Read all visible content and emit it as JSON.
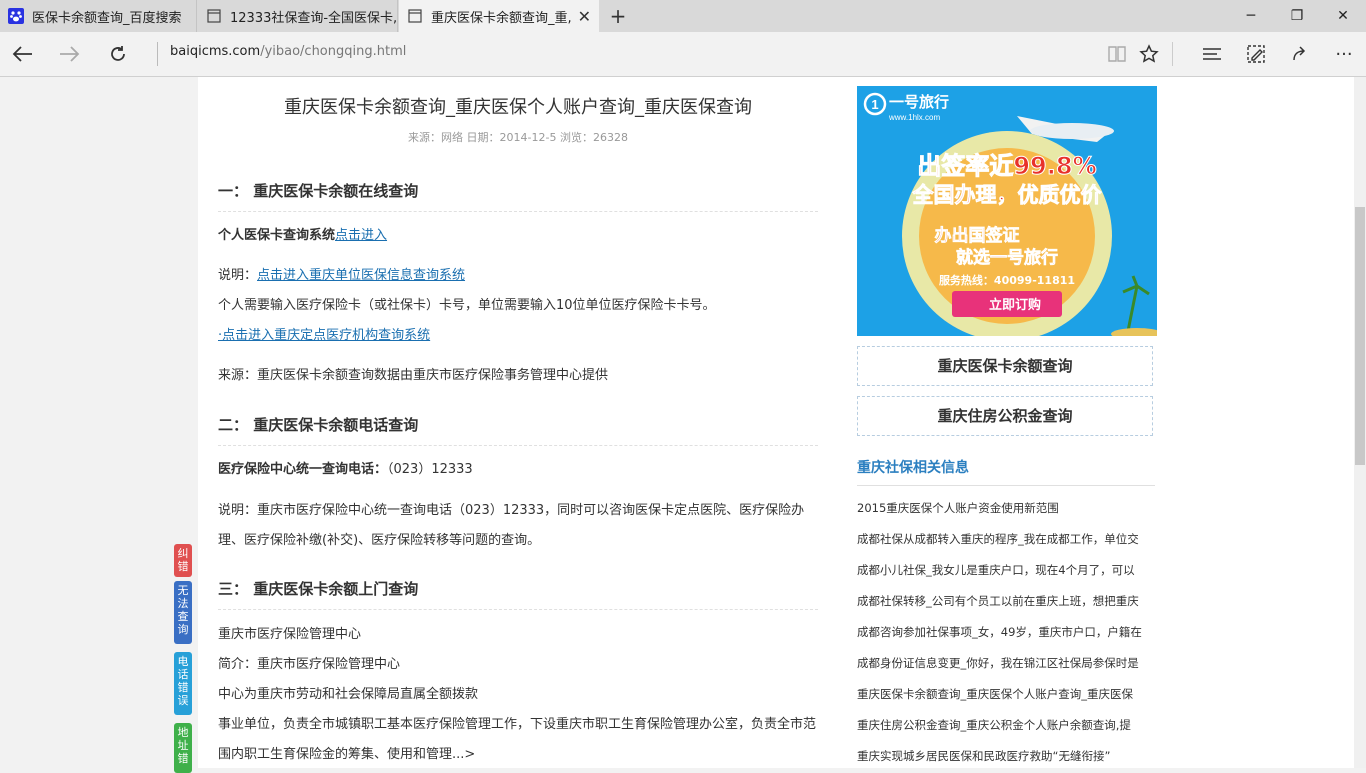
{
  "tabs": [
    {
      "title": "医保卡余额查询_百度搜索",
      "icon": "baidu-paw-icon"
    },
    {
      "title": "12333社保查询-全国医保卡,",
      "icon": "page-icon"
    },
    {
      "title": "重庆医保卡余额查询_重,",
      "icon": "page-icon",
      "active": true
    }
  ],
  "address": {
    "domain": "baiqicms.com",
    "path": "/yibao/chongqing.html"
  },
  "article": {
    "title": "重庆医保卡余额查询_重庆医保个人账户查询_重庆医保查询",
    "meta": "来源：网络 日期：2014-12-5 浏览：26328",
    "s1_heading": "一：  重庆医保卡余额在线查询",
    "s1_line1_bold": "个人医保卡查询系统",
    "s1_line1_link": "点击进入",
    "s1_line2_prefix": "说明：",
    "s1_line2_link": "点击进入重庆单位医保信息查询系统",
    "s1_line3": "个人需要输入医疗保险卡（或社保卡）卡号，单位需要输入10位单位医疗保险卡卡号。",
    "s1_line4_link": "·点击进入重庆定点医疗机构查询系统",
    "s1_line5": "来源：重庆医保卡余额查询数据由重庆市医疗保险事务管理中心提供",
    "s2_heading": "二：  重庆医保卡余额电话查询",
    "s2_line1_bold": "医疗保险中心统一查询电话：",
    "s2_line1_rest": "（023）12333",
    "s2_line2": "说明：重庆市医疗保险中心统一查询电话（023）12333，同时可以咨询医保卡定点医院、医疗保险办理、医疗保险补缴(补交)、医疗保险转移等问题的查询。",
    "s3_heading": "三：  重庆医保卡余额上门查询",
    "s3_line1": "重庆市医疗保险管理中心",
    "s3_line2": "简介：重庆市医疗保险管理中心",
    "s3_line3": "中心为重庆市劳动和社会保障局直属全额拨款",
    "s3_line4": "事业单位，负责全市城镇职工基本医疗保险管理工作，下设重庆市职工生育保险管理办公室，负责全市范围内职工生育保险金的筹集、使用和管理...>"
  },
  "sidebar": {
    "ad": {
      "brand": "一号旅行",
      "site": "www.1hlx.com",
      "line1": "出签率近99.8%",
      "line2": "全国办理，优质优价",
      "line3": "办出国签证",
      "line4": "就选一号旅行",
      "hotline": "服务热线：40099-11811",
      "button": "立即订购"
    },
    "btn1": "重庆医保卡余额查询",
    "btn2": "重庆住房公积金查询",
    "related_heading": "重庆社保相关信息",
    "related": [
      "2015重庆医保个人账户资金使用新范围",
      "成都社保从成都转入重庆的程序_我在成都工作，单位交",
      "成都小儿社保_我女儿是重庆户口，现在4个月了，可以",
      "成都社保转移_公司有个员工以前在重庆上班，想把重庆",
      "成都咨询参加社保事项_女，49岁，重庆市户口，户籍在",
      "成都身份证信息变更_你好，我在锦江区社保局参保时是",
      "重庆医保卡余额查询_重庆医保个人账户查询_重庆医保",
      "重庆住房公积金查询_重庆公积金个人账户余额查询,提",
      "重庆实现城乡居民医保和民政医疗救助“无缝衔接”"
    ]
  },
  "floating": [
    {
      "label": "纠错",
      "color": "#e05050"
    },
    {
      "label": "无法查询",
      "color": "#3a6fc4"
    },
    {
      "label": "电话错误",
      "color": "#27a0d8"
    },
    {
      "label": "地址错",
      "color": "#3fb04a"
    }
  ]
}
